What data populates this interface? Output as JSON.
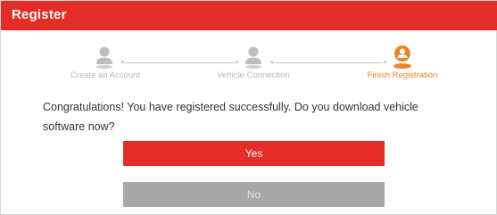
{
  "dialog": {
    "title": "Register"
  },
  "steps": [
    {
      "label": "Create an Account",
      "icon": "user-icon",
      "state": "done"
    },
    {
      "label": "Vehicle Connection",
      "icon": "user-icon",
      "state": "done"
    },
    {
      "label": "Finish Registration",
      "icon": "user-icon",
      "state": "active"
    }
  ],
  "message": {
    "text": "Congratulations! You have registered successfully. Do you download vehicle software now?"
  },
  "buttons": {
    "yes_label": "Yes",
    "no_label": "No"
  },
  "colors": {
    "accent": "#e52d27",
    "active_step": "#e8852a",
    "inactive_step": "#b8b8b8",
    "secondary_button": "#a8a8a8"
  }
}
